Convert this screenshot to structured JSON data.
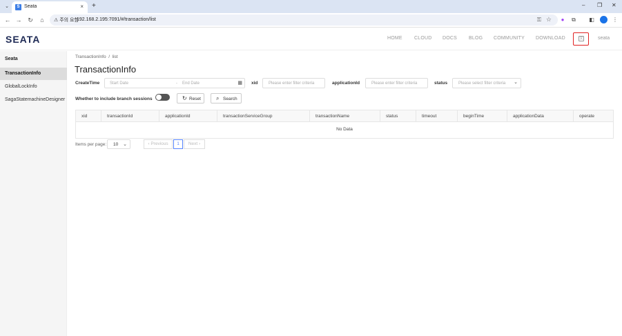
{
  "browser": {
    "tab_title": "Seata",
    "tab_favicon": "S",
    "tab_close": "×",
    "new_tab": "+",
    "address_warning": "⚠ 주의 요함",
    "url": "192.168.2.195:7091/#/transaction/list",
    "window_minimize": "–",
    "window_restore": "❐",
    "window_close": "✕"
  },
  "header": {
    "logo": "SEATA",
    "nav": [
      "HOME",
      "CLOUD",
      "DOCS",
      "BLOG",
      "COMMUNITY",
      "DOWNLOAD"
    ],
    "language_icon": "文",
    "user": "seata"
  },
  "sidebar": {
    "title": "Seata",
    "items": [
      {
        "label": "TransactionInfo",
        "active": true
      },
      {
        "label": "GlobalLockInfo",
        "active": false
      },
      {
        "label": "SagaStatemachineDesigner",
        "active": false
      }
    ]
  },
  "main": {
    "breadcrumb_root": "TransactionInfo",
    "breadcrumb_sep": "/",
    "breadcrumb_leaf": "list",
    "title": "TransactionInfo",
    "filters": {
      "create_time_label": "CreateTime",
      "start_placeholder": "Start Date",
      "end_placeholder": "End Date",
      "date_range_separator": "-",
      "xid_label": "xid",
      "xid_placeholder": "Please enter filter criteria",
      "application_id_label": "applicationId",
      "application_id_placeholder": "Please enter filter criteria",
      "status_label": "status",
      "status_placeholder": "Please select filter criteria",
      "branch_sessions_label": "Whether to include branch sessions",
      "branch_sessions_enabled": false,
      "reset_label": "Reset",
      "search_label": "Search"
    },
    "table": {
      "columns": [
        "xid",
        "transactionId",
        "applicationId",
        "transactionServiceGroup",
        "transactionName",
        "status",
        "timeout",
        "beginTime",
        "applicationData",
        "operate"
      ],
      "empty_text": "No Data"
    },
    "pagination": {
      "items_per_page_label": "Items per page:",
      "page_size": "10",
      "previous_label": "Previous",
      "current_page": "1",
      "next_label": "Next"
    }
  }
}
